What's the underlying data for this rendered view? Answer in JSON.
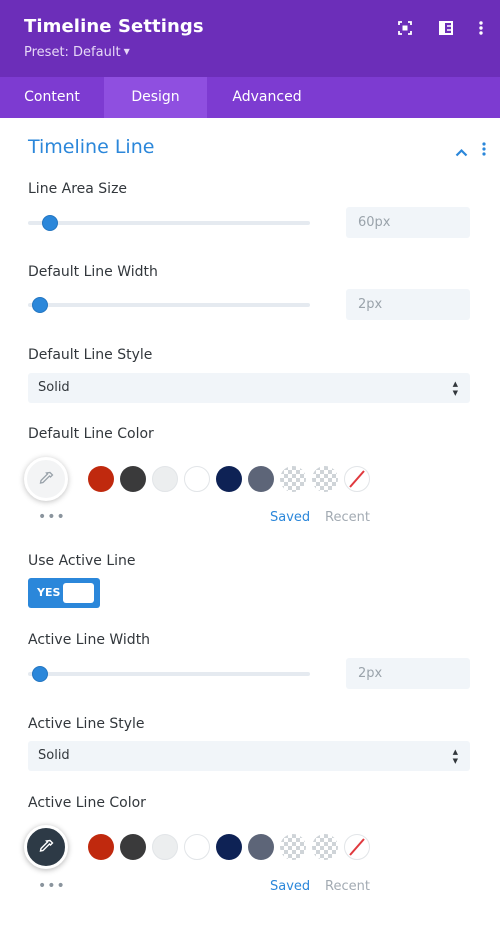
{
  "header": {
    "title": "Timeline Settings",
    "preset": "Preset: Default",
    "icons": [
      "focus-icon",
      "split-view-icon",
      "more-vertical-icon"
    ]
  },
  "tabs": [
    {
      "label": "Content",
      "active": false
    },
    {
      "label": "Design",
      "active": true
    },
    {
      "label": "Advanced",
      "active": false
    }
  ],
  "section": {
    "title": "Timeline Line",
    "line_area_size": {
      "label": "Line Area Size",
      "value": "60px"
    },
    "default_line_width": {
      "label": "Default Line Width",
      "value": "2px"
    },
    "default_line_style": {
      "label": "Default Line Style",
      "value": "Solid"
    },
    "default_line_color": {
      "label": "Default Line Color"
    },
    "use_active_line": {
      "label": "Use Active Line",
      "value": "YES"
    },
    "active_line_width": {
      "label": "Active Line Width",
      "value": "2px"
    },
    "active_line_style": {
      "label": "Active Line Style",
      "value": "Solid"
    },
    "active_line_color": {
      "label": "Active Line Color"
    }
  },
  "palette": {
    "swatches": [
      "#c0290e",
      "#3a3a3b",
      "#eceeef",
      "#ffffff",
      "#0e2255",
      "#5d6578",
      "transparent",
      "transparent",
      "none"
    ],
    "saved_label": "Saved",
    "recent_label": "Recent",
    "more_label": "•••"
  },
  "colors": {
    "header_bg": "#6c2eb9",
    "tabs_bg": "#7d3bd1",
    "accent_blue": "#2b87da"
  }
}
